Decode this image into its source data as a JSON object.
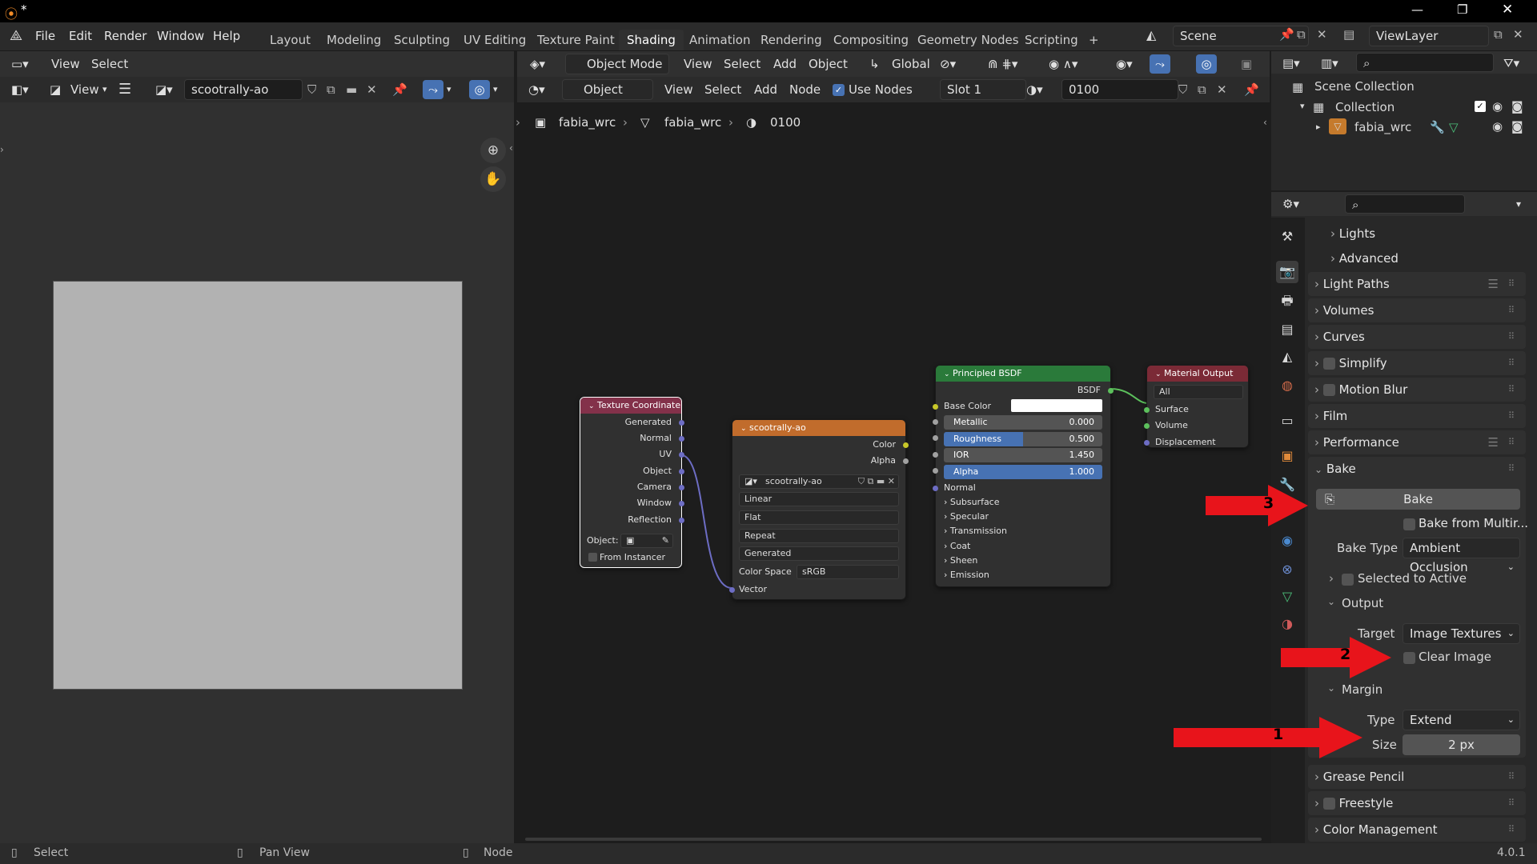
{
  "menu": {
    "file": "File",
    "edit": "Edit",
    "render": "Render",
    "window": "Window",
    "help": "Help"
  },
  "title_star": "*",
  "workspaces": [
    "Layout",
    "Modeling",
    "Sculpting",
    "UV Editing",
    "Texture Paint",
    "Shading",
    "Animation",
    "Rendering",
    "Compositing",
    "Geometry Nodes",
    "Scripting"
  ],
  "add_workspace": "+",
  "scene": "Scene",
  "view_layer": "ViewLayer",
  "image_editor": {
    "view": "View",
    "select": "Select",
    "view2": "View",
    "image_name": "scootrally-ao"
  },
  "viewport_header": {
    "mode": "Object Mode",
    "view": "View",
    "select": "Select",
    "add": "Add",
    "object": "Object",
    "transform": "Global"
  },
  "node_header": {
    "type": "Object",
    "view": "View",
    "select": "Select",
    "add": "Add",
    "node": "Node",
    "use_nodes": "Use Nodes",
    "slot": "Slot 1",
    "material": "0100"
  },
  "breadcrumb": [
    "fabia_wrc",
    "fabia_wrc",
    "0100"
  ],
  "nodes": {
    "texcoord": {
      "title": "Texture Coordinate",
      "outputs": [
        "Generated",
        "Normal",
        "UV",
        "Object",
        "Camera",
        "Window",
        "Reflection"
      ],
      "object_label": "Object:",
      "from_instancer": "From Instancer"
    },
    "image": {
      "title": "scootrally-ao",
      "out_color": "Color",
      "out_alpha": "Alpha",
      "image_name": "scootrally-ao",
      "interp": "Linear",
      "proj": "Flat",
      "ext": "Repeat",
      "source": "Generated",
      "cs_label": "Color Space",
      "cs_value": "sRGB",
      "in_vector": "Vector"
    },
    "bsdf": {
      "title": "Principled BSDF",
      "out": "BSDF",
      "base_color": "Base Color",
      "metallic": "Metallic",
      "metallic_v": "0.000",
      "roughness": "Roughness",
      "roughness_v": "0.500",
      "ior": "IOR",
      "ior_v": "1.450",
      "alpha": "Alpha",
      "alpha_v": "1.000",
      "normal": "Normal",
      "panels": [
        "Subsurface",
        "Specular",
        "Transmission",
        "Coat",
        "Sheen",
        "Emission"
      ]
    },
    "output": {
      "title": "Material Output",
      "target": "All",
      "inputs": [
        "Surface",
        "Volume",
        "Displacement"
      ]
    }
  },
  "outliner": {
    "scene_collection": "Scene Collection",
    "collection": "Collection",
    "object": "fabia_wrc"
  },
  "properties": {
    "panels_top": [
      "Lights",
      "Advanced"
    ],
    "panels": [
      "Light Paths",
      "Volumes",
      "Curves",
      "Simplify",
      "Motion Blur",
      "Film",
      "Performance"
    ],
    "bake": "Bake",
    "bake_button": "Bake",
    "bake_multires": "Bake from Multir...",
    "bake_type_label": "Bake Type",
    "bake_type": "Ambient Occlusion",
    "selected_to_active": "Selected to Active",
    "output": "Output",
    "target_label": "Target",
    "target": "Image Textures",
    "clear_image": "Clear Image",
    "margin": "Margin",
    "type_label": "Type",
    "type": "Extend",
    "size_label": "Size",
    "size": "2 px",
    "panels_bottom": [
      "Grease Pencil",
      "Freestyle",
      "Color Management"
    ]
  },
  "annotations": [
    "3",
    "2",
    "1"
  ],
  "status": {
    "select": "Select",
    "pan": "Pan View",
    "node": "Node",
    "version": "4.0.1"
  },
  "colors": {
    "accent": "#4772b3",
    "annotation": "#e8141b",
    "texcoord_head": "#83314a",
    "image_head": "#c16c2c",
    "bsdf_head": "#2a7a3a",
    "output_head": "#7b2a36"
  }
}
